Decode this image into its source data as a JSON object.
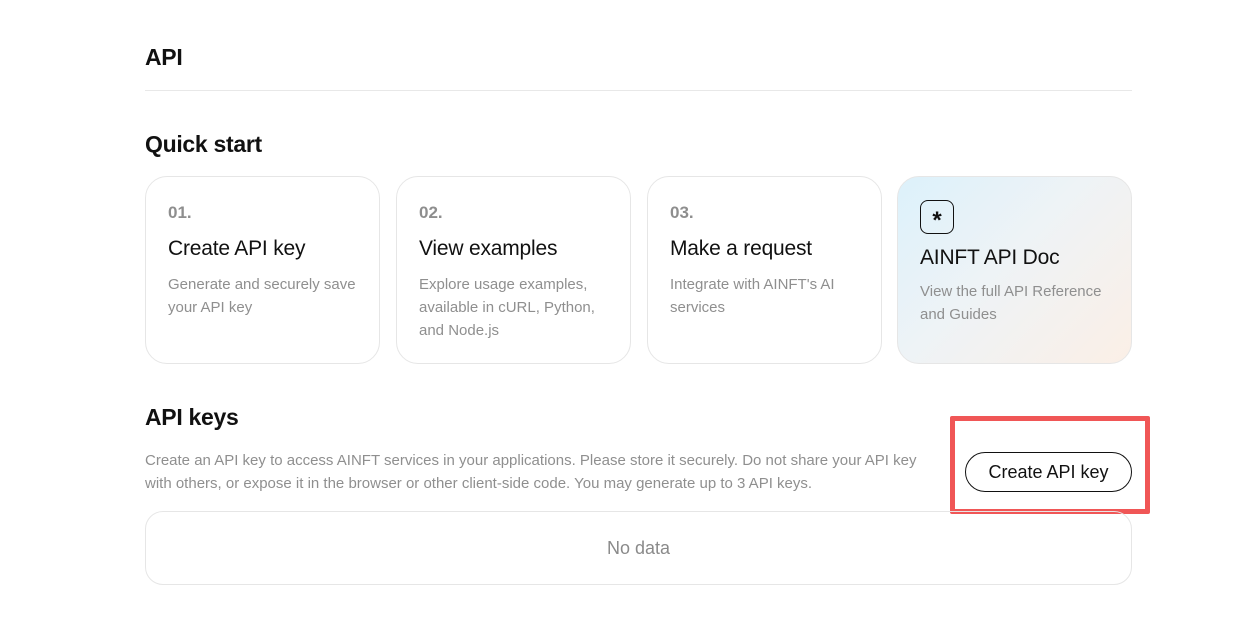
{
  "page": {
    "title": "API"
  },
  "quick_start": {
    "title": "Quick start",
    "cards": [
      {
        "number": "01.",
        "title": "Create API key",
        "description": "Generate and securely save your API key"
      },
      {
        "number": "02.",
        "title": "View examples",
        "description": "Explore usage examples, available in cURL, Python, and Node.js"
      },
      {
        "number": "03.",
        "title": "Make a request",
        "description": "Integrate with AINFT's AI services"
      }
    ],
    "doc_card": {
      "icon_glyph": "*",
      "icon": "asterisk-icon",
      "title": "AINFT API Doc",
      "description": "View the full API Reference and Guides"
    }
  },
  "api_keys": {
    "title": "API keys",
    "description": "Create an API key to access AINFT services in your applications. Please store it securely. Do not share your API key with others, or expose it in the browser or other client-side code. You may generate up to 3 API keys.",
    "create_button_label": "Create API key",
    "empty_text": "No data"
  },
  "colors": {
    "highlight": "#f05656",
    "muted_text": "#8f8f8f",
    "border": "#e6e6e6"
  }
}
